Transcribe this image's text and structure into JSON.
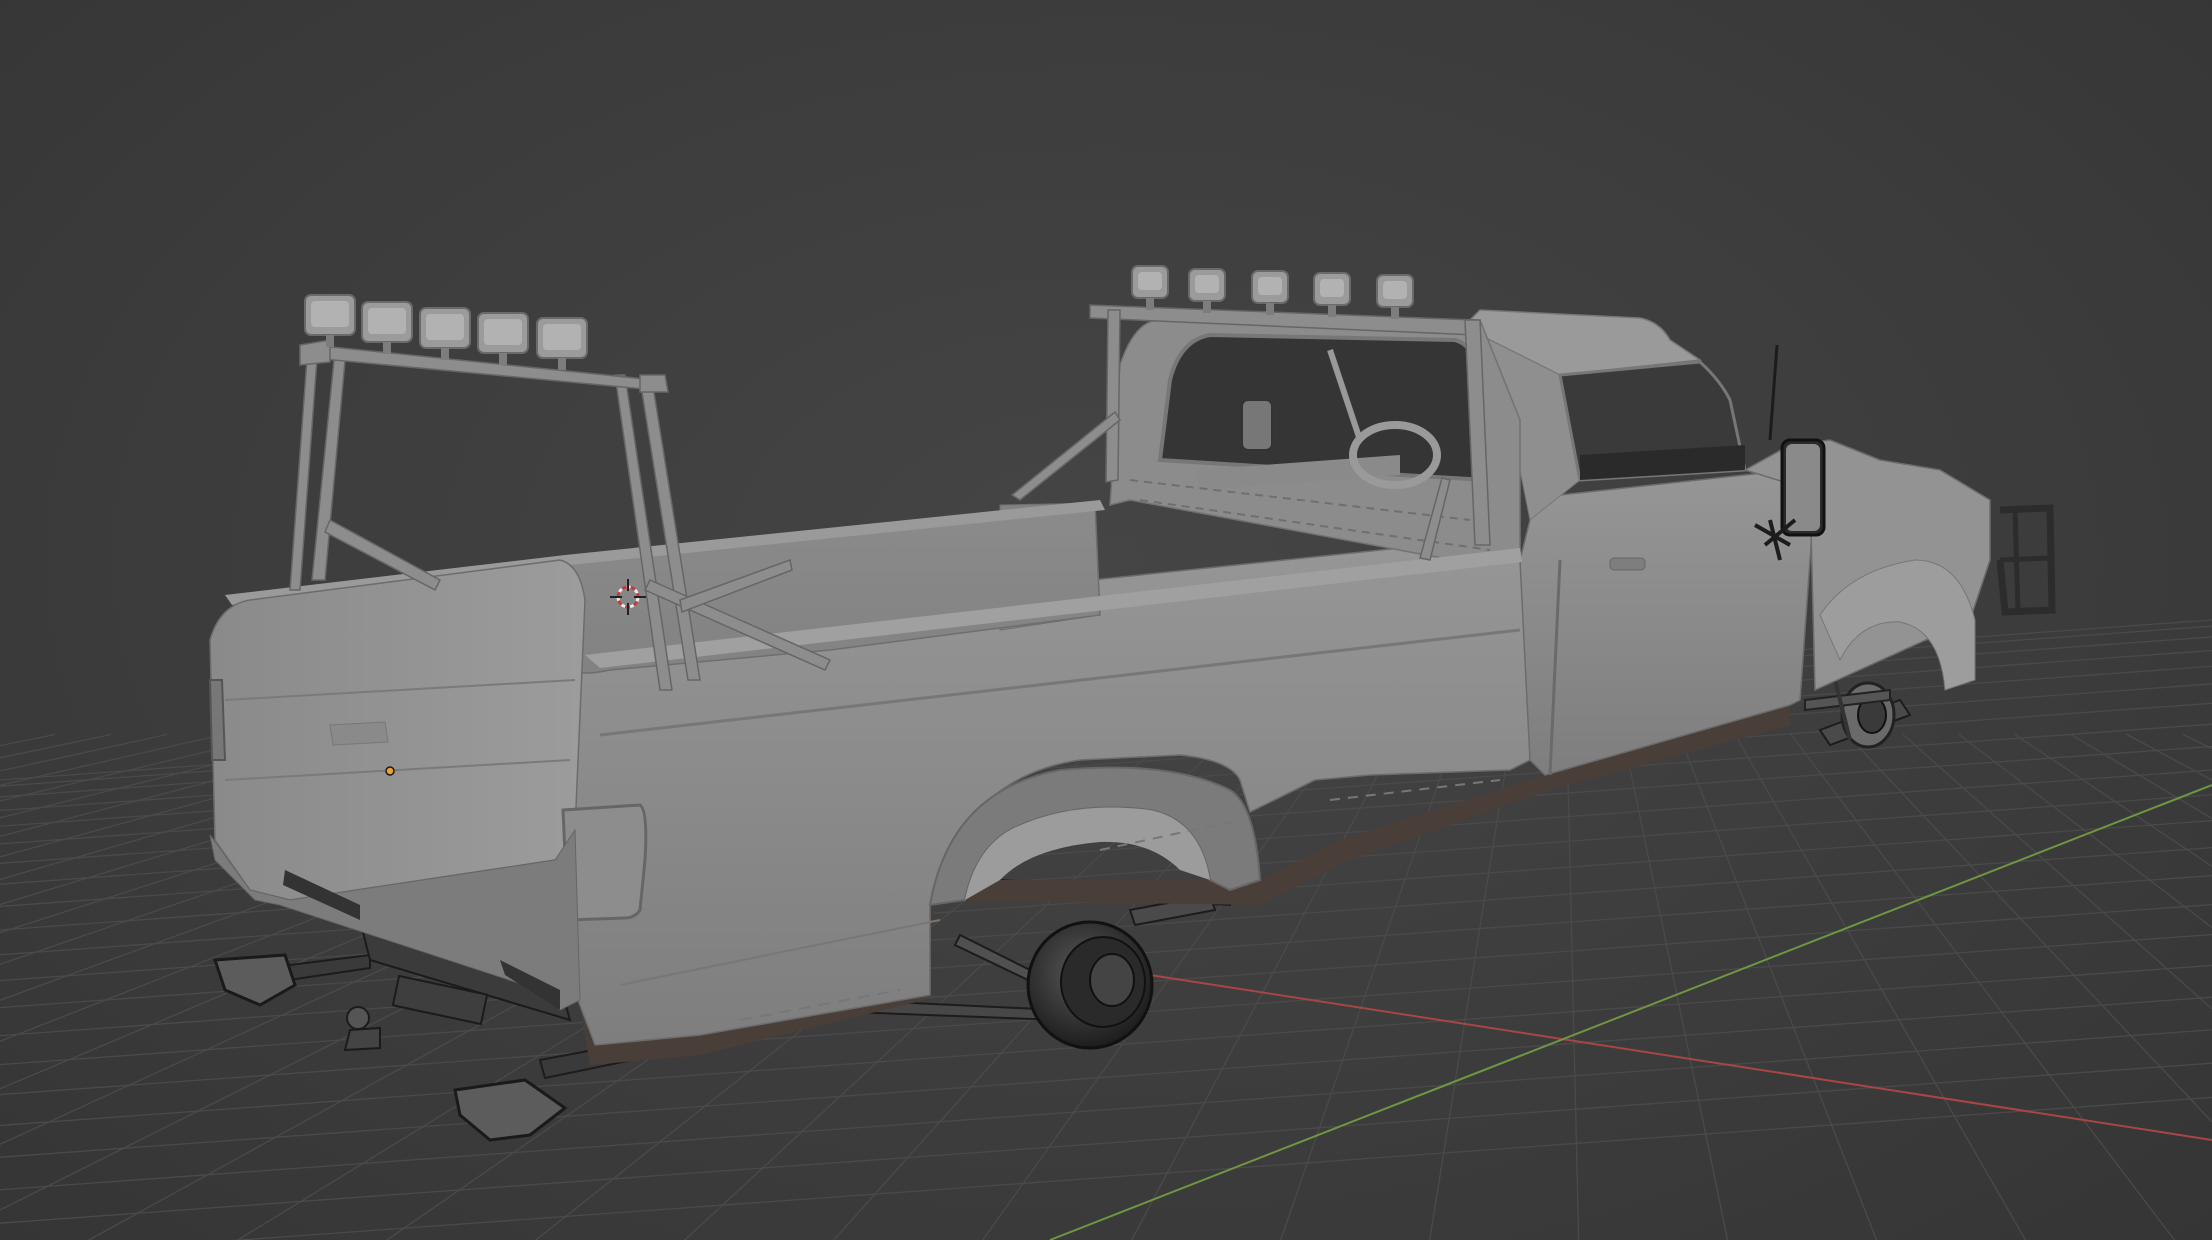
{
  "viewport": {
    "background_color": "#3d3d3d",
    "grid_color": "#4a4a4a",
    "x_axis_color": "#b84a4a",
    "y_axis_color": "#7aa24a",
    "body_color": "#8f8f8f",
    "rocker_color": "#4a3f38",
    "chrome_color": "#2a2a2a"
  },
  "scene": {
    "object": "pickup-truck-model",
    "shading": "solid",
    "has_3d_cursor": true,
    "has_origin_point": true
  }
}
